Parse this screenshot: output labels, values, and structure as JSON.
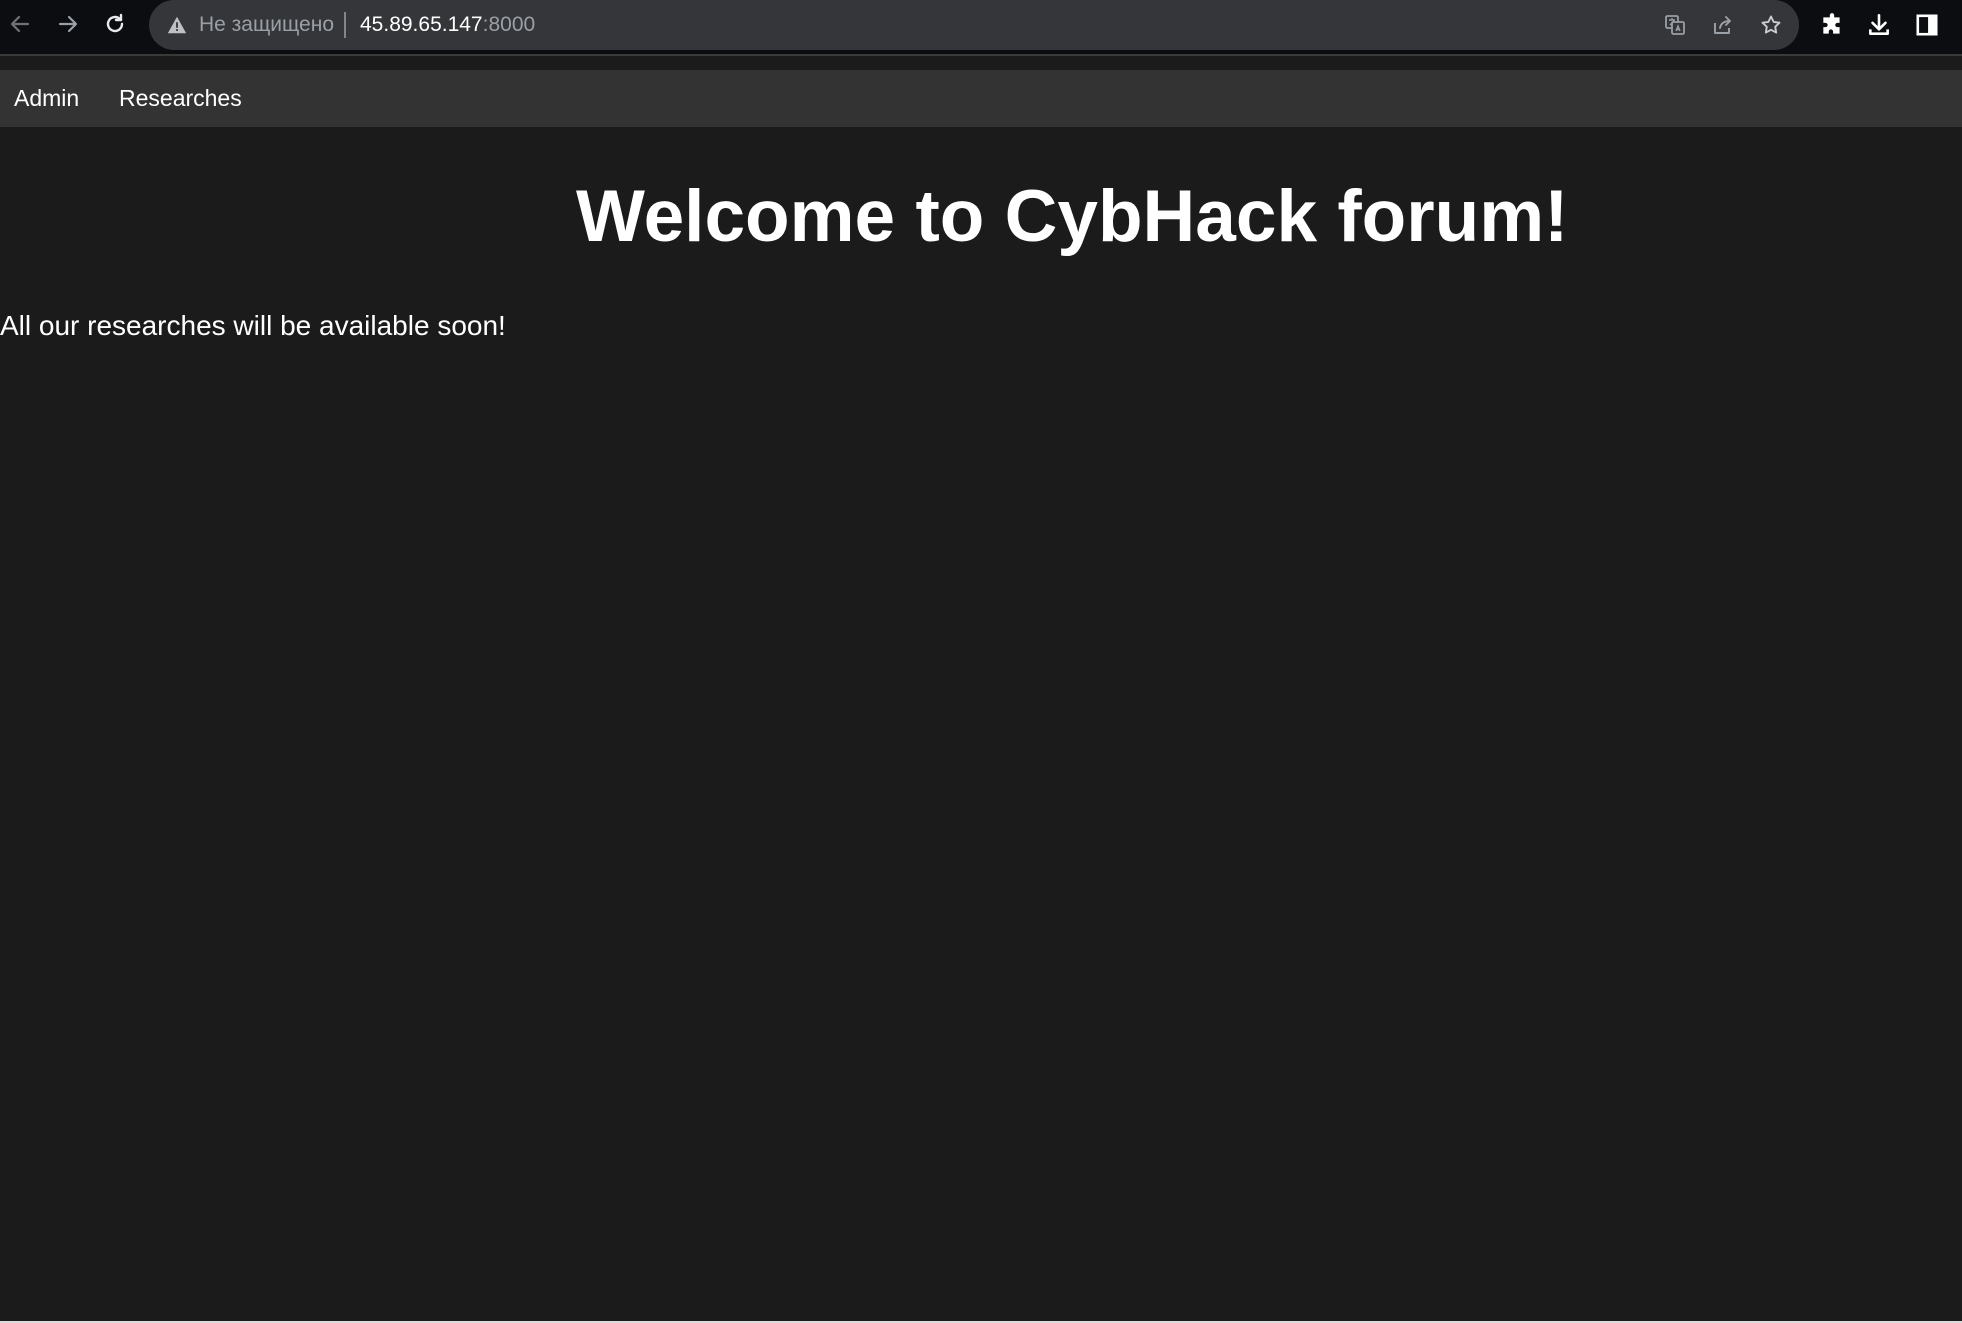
{
  "browser": {
    "security_label": "Не защищено",
    "url_host": "45.89.65.147",
    "url_port": ":8000",
    "icons": [
      "back-arrow-icon",
      "forward-arrow-icon",
      "reload-icon",
      "warning-triangle-icon",
      "translate-icon",
      "share-icon",
      "star-icon",
      "extensions-puzzle-icon",
      "download-icon",
      "side-panel-icon"
    ]
  },
  "nav": {
    "items": [
      {
        "label": "Admin"
      },
      {
        "label": "Researches"
      }
    ]
  },
  "main": {
    "title": "Welcome to CybHack forum!",
    "message": "All our researches will be available soon!"
  },
  "colors": {
    "page_background": "#1b1b1b",
    "navbar_background": "#333333",
    "text": "#ffffff",
    "browser_toolbar": "#0c0d10",
    "omnibox": "#35363a"
  }
}
